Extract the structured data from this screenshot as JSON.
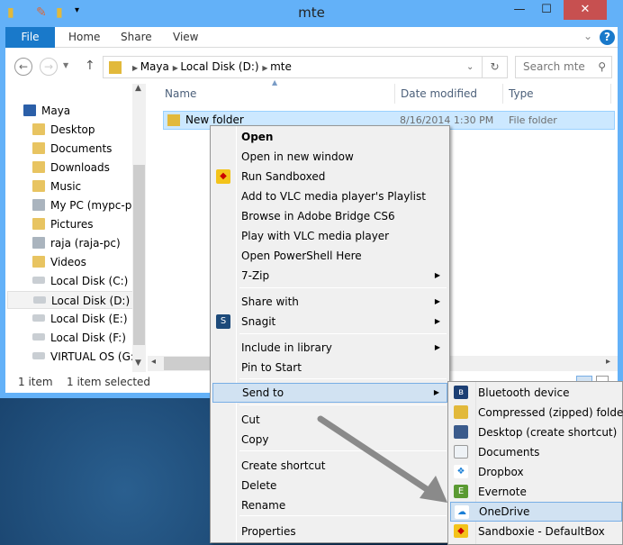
{
  "window": {
    "title": "mte",
    "minimize": "—",
    "maximize": "☐",
    "close": "✕"
  },
  "ribbon": {
    "tabs": [
      "File",
      "Home",
      "Share",
      "View"
    ],
    "help": "?",
    "expand": "⌄"
  },
  "address": {
    "path": [
      "Maya",
      "Local Disk (D:)",
      "mte"
    ],
    "search_placeholder": "Search mte"
  },
  "nav_pane": {
    "root": "Maya",
    "items": [
      {
        "label": "Desktop",
        "icon": "folder-desktop-icon"
      },
      {
        "label": "Documents",
        "icon": "folder-documents-icon"
      },
      {
        "label": "Downloads",
        "icon": "folder-downloads-icon"
      },
      {
        "label": "Music",
        "icon": "folder-music-icon"
      },
      {
        "label": "My PC (mypc-pc)",
        "icon": "network-pc-icon"
      },
      {
        "label": "Pictures",
        "icon": "folder-pictures-icon"
      },
      {
        "label": "raja (raja-pc)",
        "icon": "network-pc-icon"
      },
      {
        "label": "Videos",
        "icon": "folder-videos-icon"
      },
      {
        "label": "Local Disk (C:)",
        "icon": "drive-icon"
      },
      {
        "label": "Local Disk (D:)",
        "icon": "drive-icon",
        "selected": true
      },
      {
        "label": "Local Disk (E:)",
        "icon": "drive-icon"
      },
      {
        "label": "Local Disk (F:)",
        "icon": "drive-icon"
      },
      {
        "label": "VIRTUAL OS (G:)",
        "icon": "drive-icon"
      }
    ]
  },
  "columns": [
    "Name",
    "Date modified",
    "Type"
  ],
  "files": [
    {
      "name": "New folder",
      "date": "8/16/2014 1:30 PM",
      "type": "File folder"
    }
  ],
  "status": {
    "count": "1 item",
    "selected": "1 item selected"
  },
  "context_menu": {
    "items": [
      "Open",
      "Open in new window",
      "Run Sandboxed",
      "Add to VLC media player's Playlist",
      "Browse in Adobe Bridge CS6",
      "Play with VLC media player",
      "Open PowerShell Here",
      "7-Zip",
      "Share with",
      "Snagit",
      "Include in library",
      "Pin to Start",
      "Send to",
      "Cut",
      "Copy",
      "Create shortcut",
      "Delete",
      "Rename",
      "Properties"
    ]
  },
  "send_to": {
    "items": [
      "Bluetooth device",
      "Compressed (zipped) folder",
      "Desktop (create shortcut)",
      "Documents",
      "Dropbox",
      "Evernote",
      "OneDrive",
      "Sandboxie - DefaultBox"
    ]
  },
  "colors": {
    "titlebar": "#63b1f8",
    "file_tab": "#1979ca",
    "close": "#c75050",
    "highlight": "#d1e2f2"
  }
}
